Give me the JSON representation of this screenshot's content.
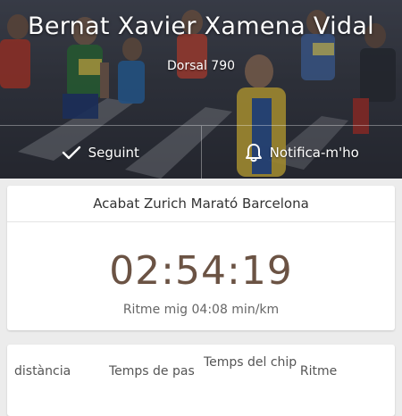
{
  "header": {
    "runner_name": "Bernat Xavier Xamena Vidal",
    "bib_label": "Dorsal 790"
  },
  "actions": {
    "follow_label": "Seguint",
    "notify_label": "Notifica-m'ho"
  },
  "result": {
    "title": "Acabat Zurich Marató Barcelona",
    "time": "02:54:19",
    "pace": "Ritme mig 04:08 min/km"
  },
  "splits": {
    "columns": [
      "distància",
      "Temps de pas",
      "Temps del chip",
      "Ritme"
    ]
  },
  "colors": {
    "time_color": "#6b5344",
    "card_bg": "#ffffff",
    "page_bg": "#ececec"
  }
}
